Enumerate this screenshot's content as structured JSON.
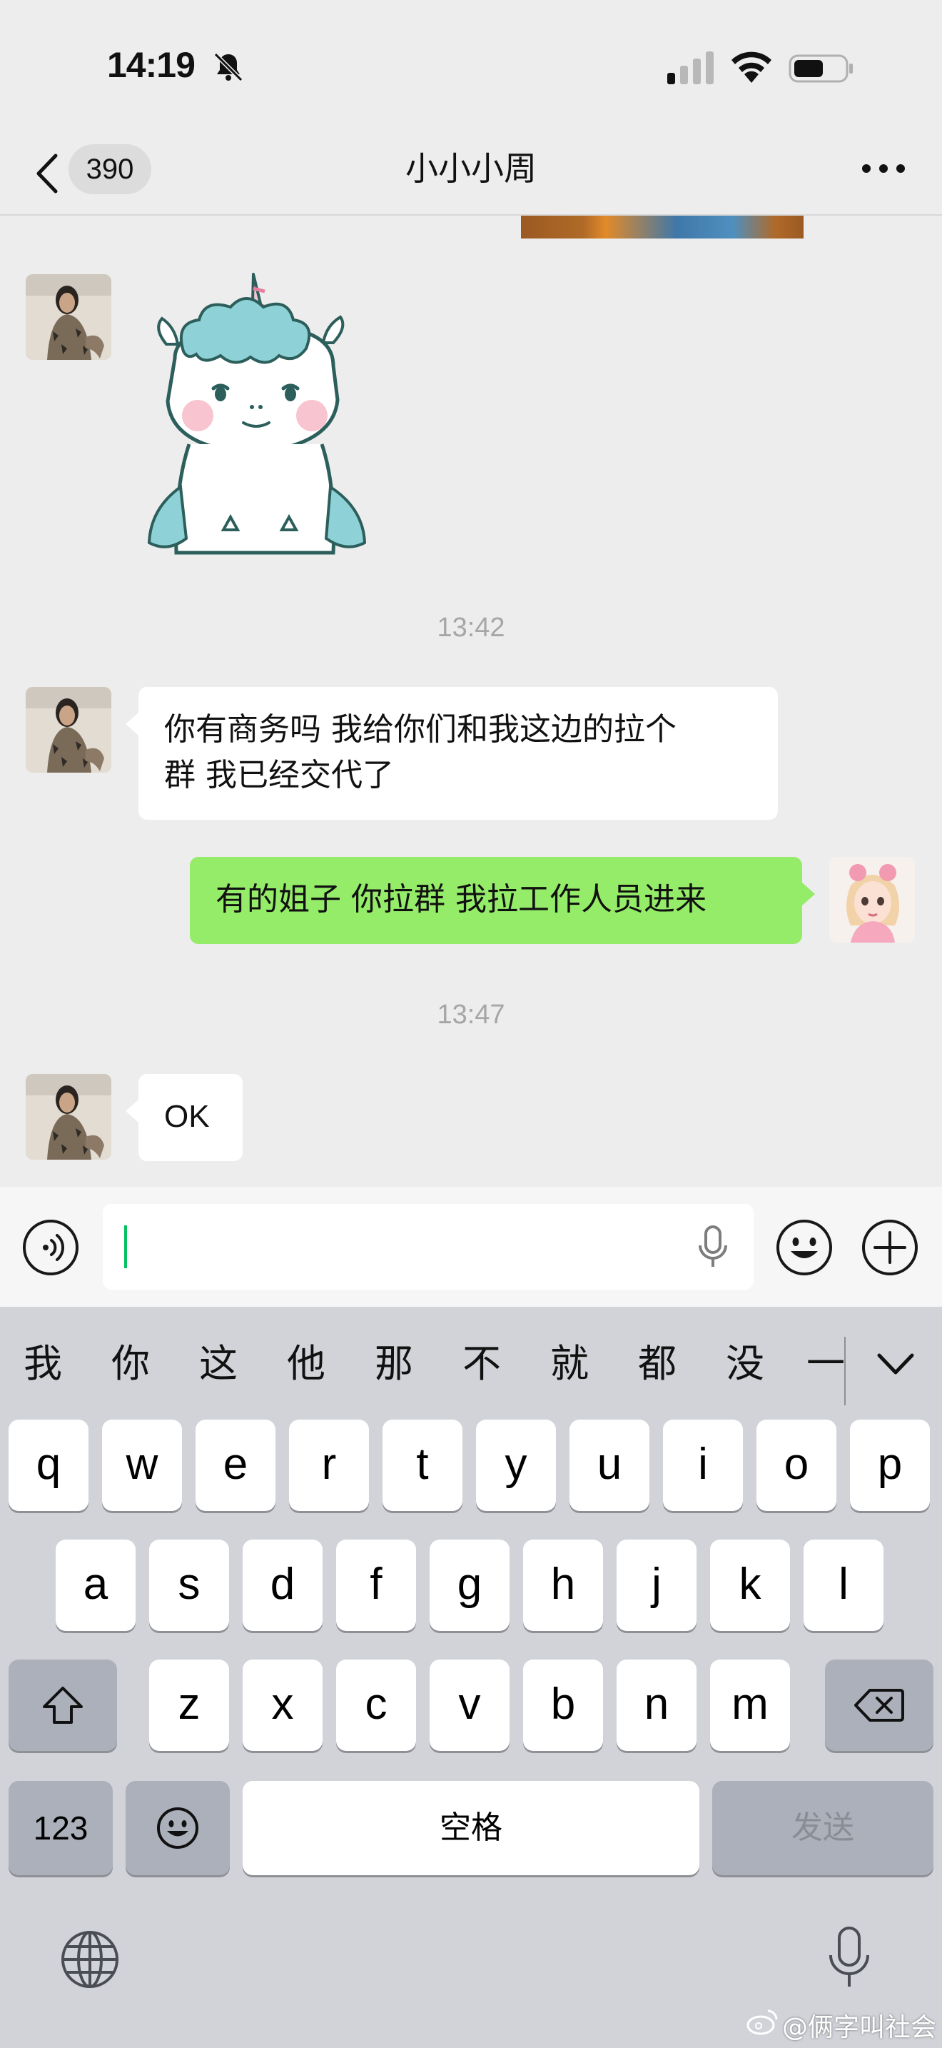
{
  "status_bar": {
    "time": "14:19"
  },
  "nav": {
    "unread_count": "390",
    "title": "小小小周"
  },
  "messages": [
    {
      "type": "time",
      "text": "13:42"
    },
    {
      "type": "received",
      "text_line1": "你有商务吗 我给你们和我这边的拉个",
      "text_line2": "群 我已经交代了"
    },
    {
      "type": "sent",
      "text": "有的姐子 你拉群 我拉工作人员进来"
    },
    {
      "type": "time",
      "text": "13:47"
    },
    {
      "type": "received",
      "text": "OK"
    }
  ],
  "keyboard": {
    "candidates": [
      "我",
      "你",
      "这",
      "他",
      "那",
      "不",
      "就",
      "都",
      "没",
      "一"
    ],
    "row1": [
      "q",
      "w",
      "e",
      "r",
      "t",
      "y",
      "u",
      "i",
      "o",
      "p"
    ],
    "row2": [
      "a",
      "s",
      "d",
      "f",
      "g",
      "h",
      "j",
      "k",
      "l"
    ],
    "row3": [
      "z",
      "x",
      "c",
      "v",
      "b",
      "n",
      "m"
    ],
    "numbers_label": "123",
    "space_label": "空格",
    "send_label": "发送"
  },
  "watermark": "@俩字叫社会",
  "colors": {
    "sent_bubble": "#95ec69",
    "received_bubble": "#ffffff",
    "chat_bg": "#ededed",
    "keyboard_bg": "#d1d3d9"
  }
}
